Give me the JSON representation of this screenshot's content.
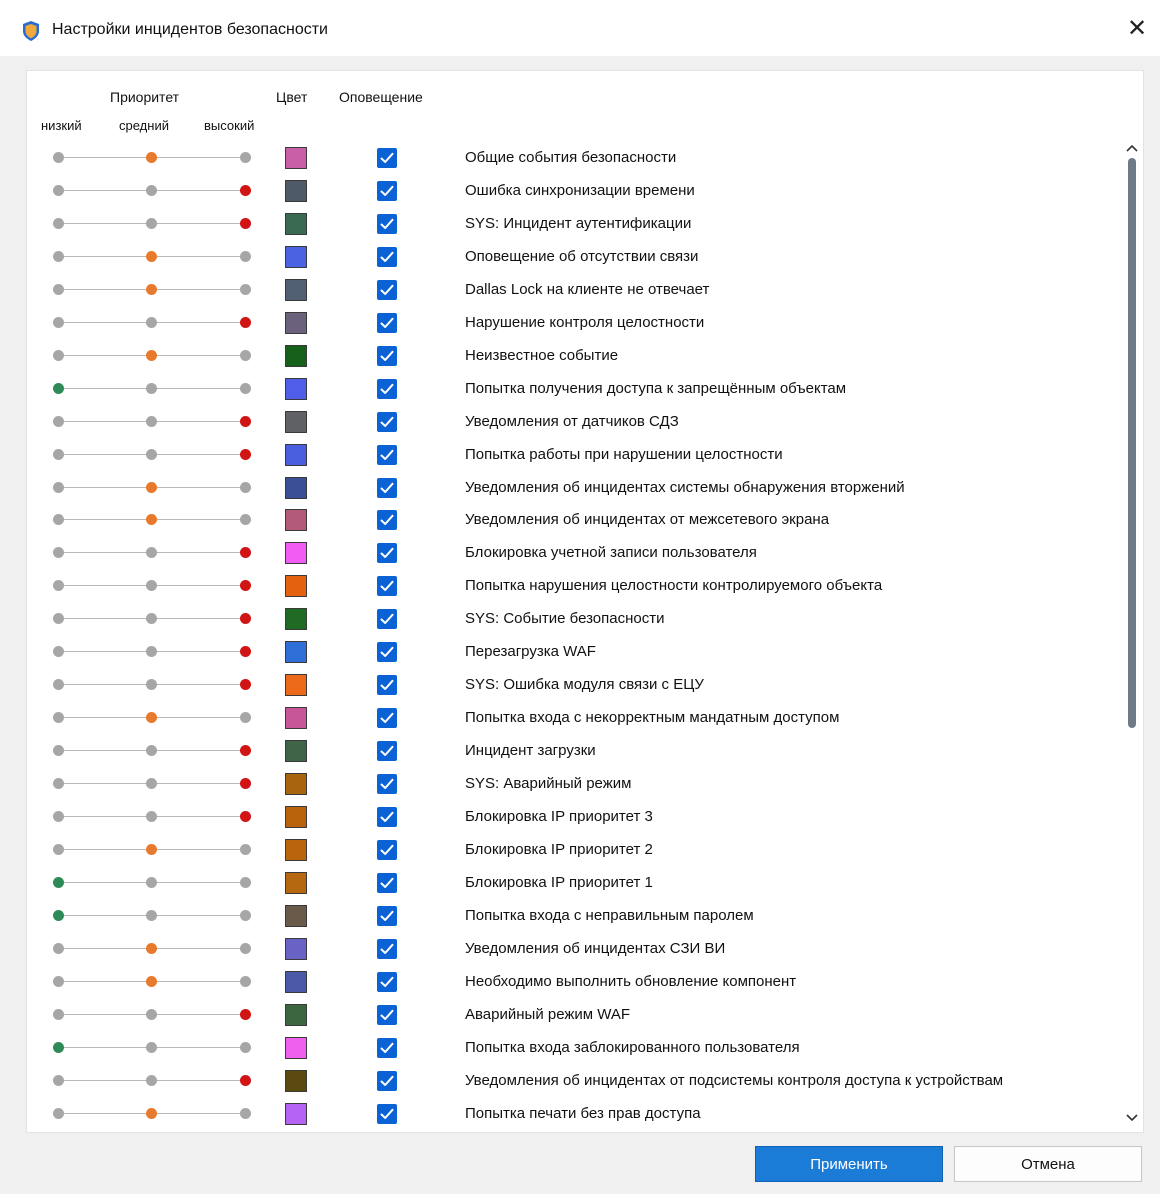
{
  "window": {
    "title": "Настройки инцидентов безопасности",
    "close_glyph": "✕"
  },
  "headers": {
    "priority": "Приоритет",
    "color": "Цвет",
    "notification": "Оповещение",
    "low": "низкий",
    "medium": "средний",
    "high": "высокий"
  },
  "priority_colors": {
    "low": "#2e8b57",
    "medium": "#e87a2d",
    "high": "#d11414",
    "inactive": "#a6a6a6"
  },
  "incidents": [
    {
      "label": "Общие события безопасности",
      "priority": "medium",
      "color": "#c95fa6",
      "notify": true
    },
    {
      "label": "Ошибка синхронизации времени",
      "priority": "high",
      "color": "#4e5a68",
      "notify": true
    },
    {
      "label": "SYS: Инцидент аутентификации",
      "priority": "high",
      "color": "#3a6a52",
      "notify": true
    },
    {
      "label": "Оповещение об отсутствии связи",
      "priority": "medium",
      "color": "#4a63e2",
      "notify": true
    },
    {
      "label": "Dallas Lock на клиенте не отвечает",
      "priority": "medium",
      "color": "#516073",
      "notify": true
    },
    {
      "label": "Нарушение контроля целостности",
      "priority": "high",
      "color": "#6b617c",
      "notify": true
    },
    {
      "label": "Неизвестное событие",
      "priority": "medium",
      "color": "#15601a",
      "notify": true
    },
    {
      "label": "Попытка получения доступа к запрещённым объектам",
      "priority": "low",
      "color": "#4f5de8",
      "notify": true
    },
    {
      "label": "Уведомления от датчиков СДЗ",
      "priority": "high",
      "color": "#5f6165",
      "notify": true
    },
    {
      "label": "Попытка работы при нарушении целостности",
      "priority": "high",
      "color": "#4a5fe0",
      "notify": true
    },
    {
      "label": "Уведомления об инцидентах системы обнаружения вторжений",
      "priority": "medium",
      "color": "#3a4f96",
      "notify": true
    },
    {
      "label": "Уведомления об инцидентах от межсетевого экрана",
      "priority": "medium",
      "color": "#b35a7a",
      "notify": true
    },
    {
      "label": "Блокировка учетной записи пользователя",
      "priority": "high",
      "color": "#f35cf3",
      "notify": true
    },
    {
      "label": "Попытка нарушения целостности контролируемого объекта",
      "priority": "high",
      "color": "#e3610f",
      "notify": true
    },
    {
      "label": "SYS: Событие безопасности",
      "priority": "high",
      "color": "#1f6b24",
      "notify": true
    },
    {
      "label": "Перезагрузка WAF",
      "priority": "high",
      "color": "#2f6fd8",
      "notify": true
    },
    {
      "label": "SYS: Ошибка модуля связи с ЕЦУ",
      "priority": "high",
      "color": "#ec6a1a",
      "notify": true
    },
    {
      "label": "Попытка входа с некорректным мандатным доступом",
      "priority": "medium",
      "color": "#c65698",
      "notify": true
    },
    {
      "label": "Инцидент загрузки",
      "priority": "high",
      "color": "#3f6447",
      "notify": true
    },
    {
      "label": "SYS: Аварийный режим",
      "priority": "high",
      "color": "#a8650f",
      "notify": true
    },
    {
      "label": "Блокировка IP приоритет 3",
      "priority": "high",
      "color": "#b8630b",
      "notify": true
    },
    {
      "label": "Блокировка IP приоритет 2",
      "priority": "medium",
      "color": "#b8650c",
      "notify": true
    },
    {
      "label": "Блокировка IP приоритет 1",
      "priority": "low",
      "color": "#b66810",
      "notify": true
    },
    {
      "label": "Попытка входа с неправильным паролем",
      "priority": "low",
      "color": "#6a5a4a",
      "notify": true
    },
    {
      "label": "Уведомления об инцидентах СЗИ ВИ",
      "priority": "medium",
      "color": "#6a63c6",
      "notify": true
    },
    {
      "label": "Необходимо выполнить обновление компонент",
      "priority": "medium",
      "color": "#4a5aa8",
      "notify": true
    },
    {
      "label": "Аварийный режим WAF",
      "priority": "high",
      "color": "#3c6640",
      "notify": true
    },
    {
      "label": "Попытка входа заблокированного пользователя",
      "priority": "low",
      "color": "#f060ee",
      "notify": true
    },
    {
      "label": "Уведомления об инцидентах от подсистемы контроля доступа к устройствам",
      "priority": "high",
      "color": "#5a4a0f",
      "notify": true
    },
    {
      "label": "Попытка печати без прав доступа",
      "priority": "medium",
      "color": "#b563f2",
      "notify": true
    }
  ],
  "buttons": {
    "apply": "Применить",
    "cancel": "Отмена"
  }
}
